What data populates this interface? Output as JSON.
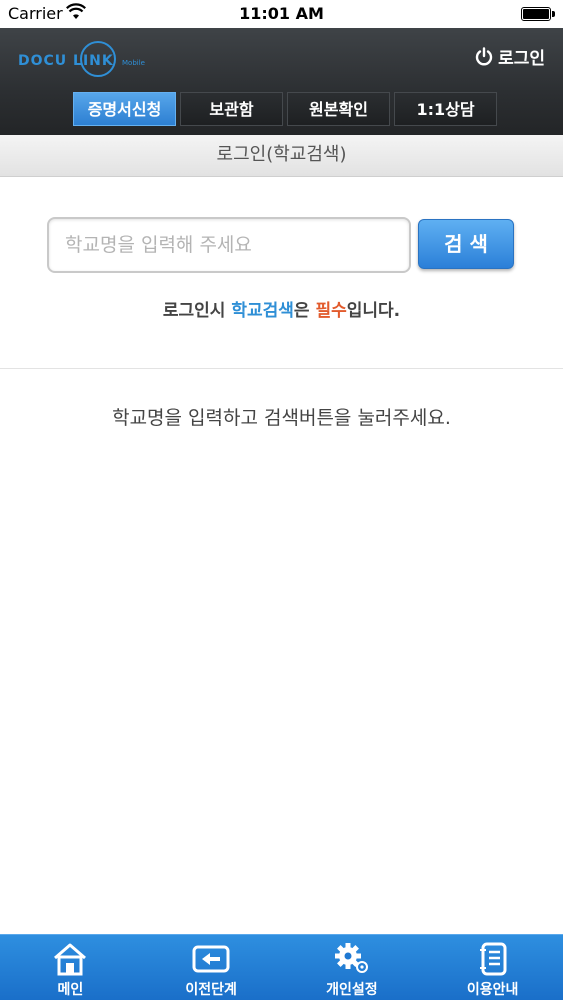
{
  "status_bar": {
    "carrier": "Carrier",
    "time": "11:01 AM"
  },
  "header": {
    "logo_text": "DOCU LINK",
    "logo_subtext": "Mobile",
    "login_label": "로그인",
    "tabs": [
      {
        "label": "증명서신청",
        "active": true
      },
      {
        "label": "보관함",
        "active": false
      },
      {
        "label": "원본확인",
        "active": false
      },
      {
        "label": "1:1상담",
        "active": false
      }
    ]
  },
  "subheader": {
    "title": "로그인(학교검색)"
  },
  "search": {
    "placeholder": "학교명을 입력해 주세요",
    "value": "",
    "button_label": "검 색"
  },
  "notice": {
    "prefix": "로그인시 ",
    "highlight_blue": "학교검색",
    "middle": "은 ",
    "highlight_red": "필수",
    "suffix": "입니다."
  },
  "hint": "학교명을 입력하고 검색버튼을 눌러주세요.",
  "bottom_nav": [
    {
      "label": "메인",
      "icon": "home-icon"
    },
    {
      "label": "이전단계",
      "icon": "back-arrow-icon"
    },
    {
      "label": "개인설정",
      "icon": "gear-icon"
    },
    {
      "label": "이용안내",
      "icon": "guide-book-icon"
    }
  ],
  "colors": {
    "accent_blue": "#2b7fd8",
    "header_dark": "#2c2f32",
    "notice_blue": "#2f8fd6",
    "notice_red": "#e25b2d"
  }
}
